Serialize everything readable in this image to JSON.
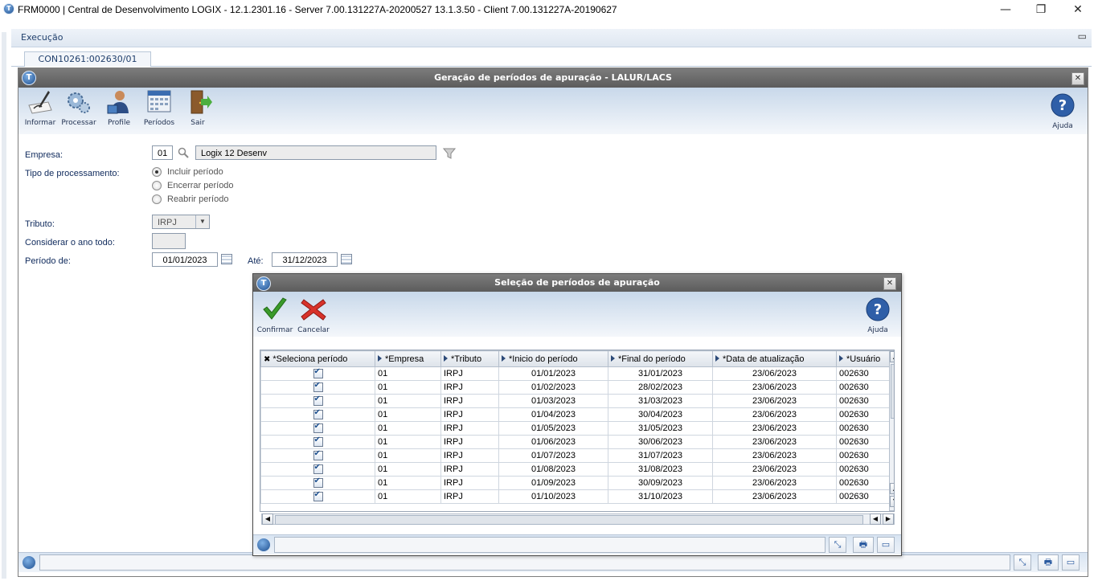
{
  "window": {
    "title": "FRM0000 | Central de Desenvolvimento LOGIX  -  12.1.2301.16 - Server 7.00.131227A-20200527 13.1.3.50 - Client 7.00.131227A-20190627",
    "minimize": "—",
    "restore": "❐",
    "close": "✕"
  },
  "menu": {
    "item": "Execução",
    "restore_icon": "▭"
  },
  "tabs": [
    {
      "label": "CON10261:002630/01"
    }
  ],
  "main": {
    "title": "Geração de períodos de apuração - LALUR/LACS",
    "toolbar": [
      {
        "label": "Informar",
        "icon": "pen-paper-icon"
      },
      {
        "label": "Processar",
        "icon": "gears-icon"
      },
      {
        "label": "Profile",
        "icon": "user-profile-icon"
      },
      {
        "label": "Períodos",
        "icon": "calendar-icon"
      },
      {
        "label": "Sair",
        "icon": "exit-door-icon"
      }
    ],
    "help_label": "Ajuda",
    "form": {
      "empresa_label": "Empresa:",
      "empresa_code": "01",
      "empresa_name": "Logix 12 Desenv",
      "tipo_label": "Tipo de processamento:",
      "radios": [
        {
          "label": "Incluir período",
          "selected": true
        },
        {
          "label": "Encerrar período",
          "selected": false
        },
        {
          "label": "Reabrir período",
          "selected": false
        }
      ],
      "tributo_label": "Tributo:",
      "tributo_value": "IRPJ",
      "considerar_label": "Considerar o ano todo:",
      "considerar_value": "",
      "periodo_label": "Período de:",
      "periodo_de": "01/01/2023",
      "ate_label": "Até:",
      "periodo_ate": "31/12/2023"
    }
  },
  "dialog": {
    "title": "Seleção de períodos de apuração",
    "confirm_label": "Confirmar",
    "cancel_label": "Cancelar",
    "help_label": "Ajuda",
    "columns": [
      "*Seleciona período",
      "*Empresa",
      "*Tributo",
      "*Inicio do período",
      "*Final do período",
      "*Data de atualização",
      "*Usuário"
    ],
    "rows": [
      {
        "empresa": "01",
        "tributo": "IRPJ",
        "inicio": "01/01/2023",
        "final": "31/01/2023",
        "atualizacao": "23/06/2023",
        "usuario": "002630"
      },
      {
        "empresa": "01",
        "tributo": "IRPJ",
        "inicio": "01/02/2023",
        "final": "28/02/2023",
        "atualizacao": "23/06/2023",
        "usuario": "002630"
      },
      {
        "empresa": "01",
        "tributo": "IRPJ",
        "inicio": "01/03/2023",
        "final": "31/03/2023",
        "atualizacao": "23/06/2023",
        "usuario": "002630"
      },
      {
        "empresa": "01",
        "tributo": "IRPJ",
        "inicio": "01/04/2023",
        "final": "30/04/2023",
        "atualizacao": "23/06/2023",
        "usuario": "002630"
      },
      {
        "empresa": "01",
        "tributo": "IRPJ",
        "inicio": "01/05/2023",
        "final": "31/05/2023",
        "atualizacao": "23/06/2023",
        "usuario": "002630"
      },
      {
        "empresa": "01",
        "tributo": "IRPJ",
        "inicio": "01/06/2023",
        "final": "30/06/2023",
        "atualizacao": "23/06/2023",
        "usuario": "002630"
      },
      {
        "empresa": "01",
        "tributo": "IRPJ",
        "inicio": "01/07/2023",
        "final": "31/07/2023",
        "atualizacao": "23/06/2023",
        "usuario": "002630"
      },
      {
        "empresa": "01",
        "tributo": "IRPJ",
        "inicio": "01/08/2023",
        "final": "31/08/2023",
        "atualizacao": "23/06/2023",
        "usuario": "002630"
      },
      {
        "empresa": "01",
        "tributo": "IRPJ",
        "inicio": "01/09/2023",
        "final": "30/09/2023",
        "atualizacao": "23/06/2023",
        "usuario": "002630"
      },
      {
        "empresa": "01",
        "tributo": "IRPJ",
        "inicio": "01/10/2023",
        "final": "31/10/2023",
        "atualizacao": "23/06/2023",
        "usuario": "002630"
      }
    ]
  }
}
